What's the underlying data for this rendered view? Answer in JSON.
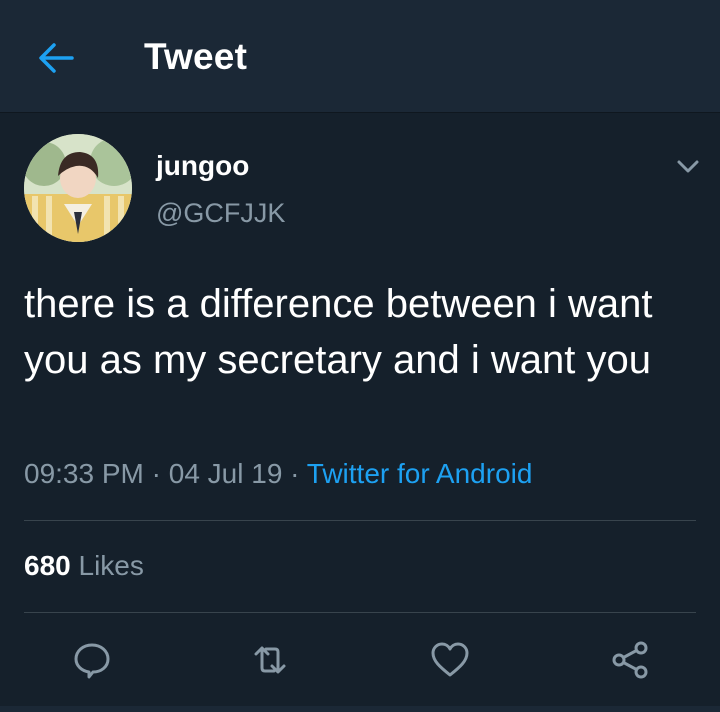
{
  "header": {
    "title": "Tweet",
    "back_icon": "arrow-left-icon"
  },
  "tweet": {
    "author_name": "jungoo",
    "handle": "@GCFJJK",
    "text": "there is a difference between i want you as my secretary and i want you",
    "time": "09:33 PM",
    "sep1": " · ",
    "date": "04 Jul 19",
    "sep2": " · ",
    "source": "Twitter for Android",
    "likes_count": "680",
    "likes_label": " Likes"
  },
  "actions": [
    "reply-icon",
    "retweet-icon",
    "like-icon",
    "share-icon"
  ],
  "colors": {
    "background": "#15202b",
    "header": "#1b2836",
    "accent": "#1da1f2",
    "muted": "#8899a6",
    "divider": "#38444d"
  }
}
